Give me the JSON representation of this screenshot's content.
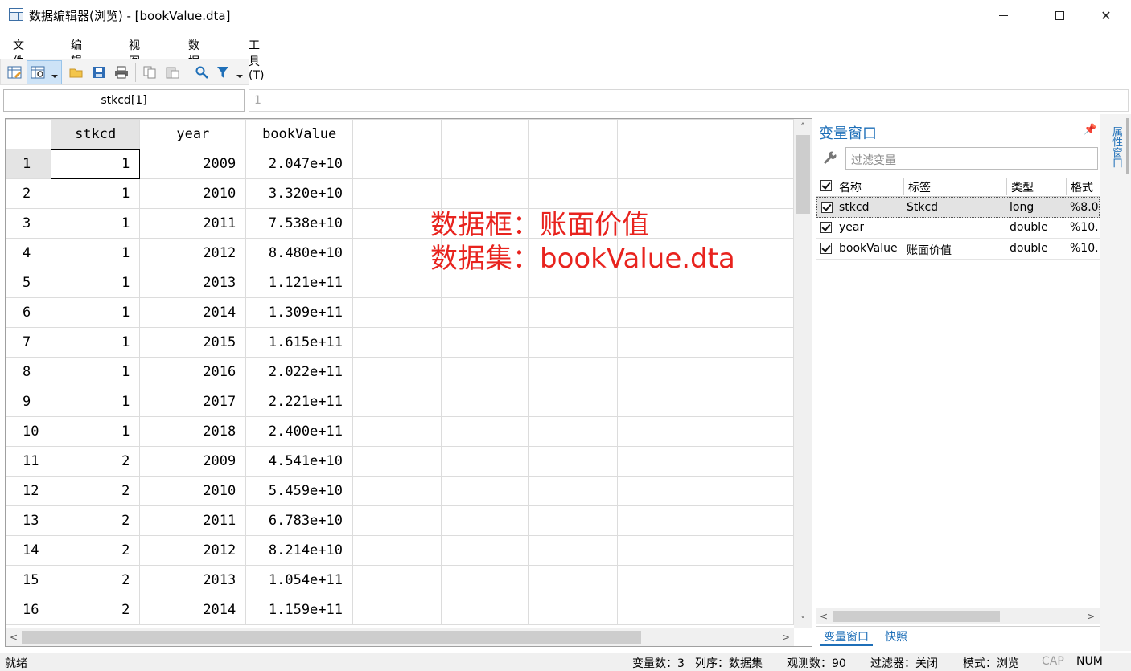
{
  "window": {
    "title": "数据编辑器(浏览) - [bookValue.dta]",
    "minimize_label": "",
    "maximize_label": "",
    "close_label": "✕"
  },
  "menu": [
    "文件(F)",
    "编辑(E)",
    "视图(V)",
    "数据(D)",
    "工具(T)"
  ],
  "toolbar": {
    "icons": [
      "data-editor-edit-icon",
      "data-editor-browse-icon",
      "open-folder-icon",
      "save-icon",
      "print-icon",
      "copy-icon",
      "paste-icon",
      "find-icon",
      "filter-icon"
    ],
    "accent": "#1e6fb8"
  },
  "cellbar": {
    "varname": "stkcd[1]",
    "value": "1"
  },
  "grid": {
    "columns": [
      "stkcd",
      "year",
      "bookValue"
    ],
    "rows": [
      {
        "n": "1",
        "stkcd": "1",
        "year": "2009",
        "bookValue": "2.047e+10"
      },
      {
        "n": "2",
        "stkcd": "1",
        "year": "2010",
        "bookValue": "3.320e+10"
      },
      {
        "n": "3",
        "stkcd": "1",
        "year": "2011",
        "bookValue": "7.538e+10"
      },
      {
        "n": "4",
        "stkcd": "1",
        "year": "2012",
        "bookValue": "8.480e+10"
      },
      {
        "n": "5",
        "stkcd": "1",
        "year": "2013",
        "bookValue": "1.121e+11"
      },
      {
        "n": "6",
        "stkcd": "1",
        "year": "2014",
        "bookValue": "1.309e+11"
      },
      {
        "n": "7",
        "stkcd": "1",
        "year": "2015",
        "bookValue": "1.615e+11"
      },
      {
        "n": "8",
        "stkcd": "1",
        "year": "2016",
        "bookValue": "2.022e+11"
      },
      {
        "n": "9",
        "stkcd": "1",
        "year": "2017",
        "bookValue": "2.221e+11"
      },
      {
        "n": "10",
        "stkcd": "1",
        "year": "2018",
        "bookValue": "2.400e+11"
      },
      {
        "n": "11",
        "stkcd": "2",
        "year": "2009",
        "bookValue": "4.541e+10"
      },
      {
        "n": "12",
        "stkcd": "2",
        "year": "2010",
        "bookValue": "5.459e+10"
      },
      {
        "n": "13",
        "stkcd": "2",
        "year": "2011",
        "bookValue": "6.783e+10"
      },
      {
        "n": "14",
        "stkcd": "2",
        "year": "2012",
        "bookValue": "8.214e+10"
      },
      {
        "n": "15",
        "stkcd": "2",
        "year": "2013",
        "bookValue": "1.054e+11"
      },
      {
        "n": "16",
        "stkcd": "2",
        "year": "2014",
        "bookValue": "1.159e+11"
      }
    ],
    "selected_row": "1",
    "selected_column": "stkcd"
  },
  "annotation": {
    "line1": "数据框：账面价值",
    "line2": "数据集：bookValue.dta",
    "color": "#e8231e"
  },
  "variables_panel": {
    "title": "变量窗口",
    "filter_placeholder": "过滤变量",
    "headers": {
      "name": "名称",
      "label": "标签",
      "type": "类型",
      "format": "格式"
    },
    "vars": [
      {
        "name": "stkcd",
        "label": "Stkcd",
        "type": "long",
        "format": "%8.0"
      },
      {
        "name": "year",
        "label": "",
        "type": "double",
        "format": "%10."
      },
      {
        "name": "bookValue",
        "label": "账面价值",
        "type": "double",
        "format": "%10."
      }
    ],
    "tabs": [
      "变量窗口",
      "快照"
    ]
  },
  "properties_tab": "属性窗口",
  "status": {
    "ready": "就绪",
    "vars": "变量数：3",
    "order": "列序：数据集",
    "obs": "观测数：90",
    "filter": "过滤器：关闭",
    "mode": "模式：浏览",
    "cap": "CAP",
    "num": "NUM"
  }
}
